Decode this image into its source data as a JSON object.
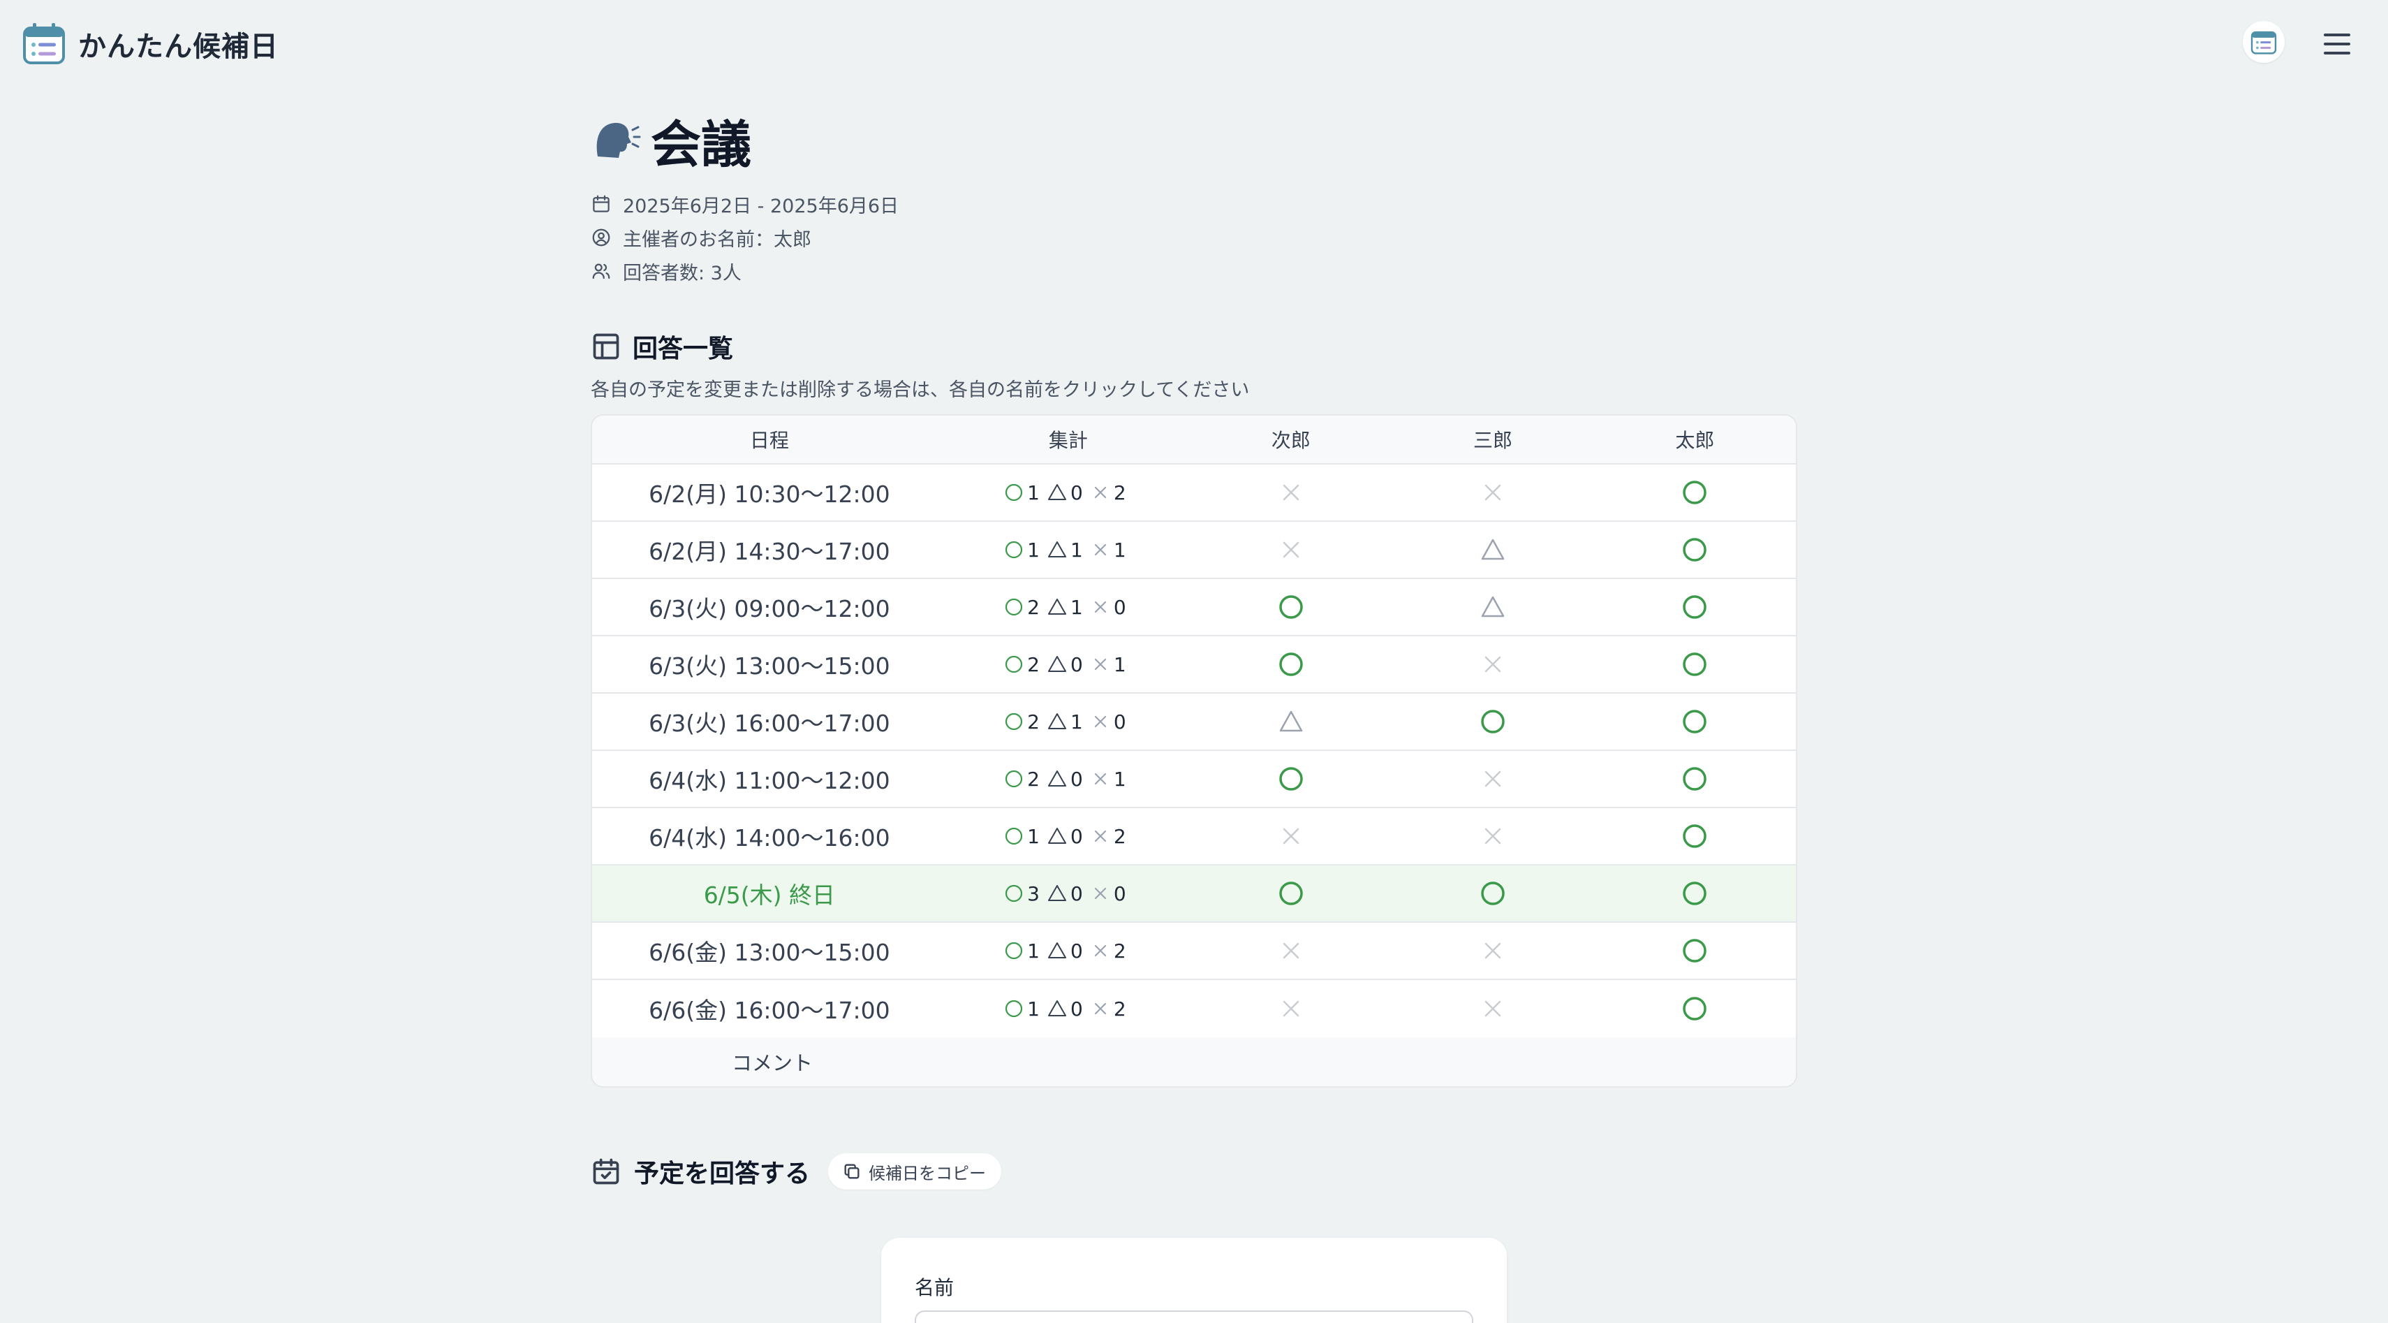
{
  "app": {
    "name": "かんたん候補日"
  },
  "event": {
    "title": "会議",
    "emoji": "🗣️",
    "date_range": "2025年6月2日 - 2025年6月6日",
    "organizer": "主催者のお名前：太郎",
    "respondents": "回答者数: 3人"
  },
  "responses": {
    "title": "回答一覧",
    "hint": "各自の予定を変更または削除する場合は、各自の名前をクリックしてください",
    "headers": {
      "date": "日程",
      "summary": "集計"
    },
    "participants": [
      "次郎",
      "三郎",
      "太郎"
    ],
    "rows": [
      {
        "date": "6/2(月) 10:30〜12:00",
        "ok": "1",
        "maybe": "0",
        "ng": "2",
        "marks": [
          "ng",
          "ng",
          "ok"
        ],
        "best": false
      },
      {
        "date": "6/2(月) 14:30〜17:00",
        "ok": "1",
        "maybe": "1",
        "ng": "1",
        "marks": [
          "ng",
          "maybe",
          "ok"
        ],
        "best": false
      },
      {
        "date": "6/3(火) 09:00〜12:00",
        "ok": "2",
        "maybe": "1",
        "ng": "0",
        "marks": [
          "ok",
          "maybe",
          "ok"
        ],
        "best": false
      },
      {
        "date": "6/3(火) 13:00〜15:00",
        "ok": "2",
        "maybe": "0",
        "ng": "1",
        "marks": [
          "ok",
          "ng",
          "ok"
        ],
        "best": false
      },
      {
        "date": "6/3(火) 16:00〜17:00",
        "ok": "2",
        "maybe": "1",
        "ng": "0",
        "marks": [
          "maybe",
          "ok",
          "ok"
        ],
        "best": false
      },
      {
        "date": "6/4(水) 11:00〜12:00",
        "ok": "2",
        "maybe": "0",
        "ng": "1",
        "marks": [
          "ok",
          "ng",
          "ok"
        ],
        "best": false
      },
      {
        "date": "6/4(水) 14:00〜16:00",
        "ok": "1",
        "maybe": "0",
        "ng": "2",
        "marks": [
          "ng",
          "ng",
          "ok"
        ],
        "best": false
      },
      {
        "date": "6/5(木) 終日",
        "ok": "3",
        "maybe": "0",
        "ng": "0",
        "marks": [
          "ok",
          "ok",
          "ok"
        ],
        "best": true
      },
      {
        "date": "6/6(金) 13:00〜15:00",
        "ok": "1",
        "maybe": "0",
        "ng": "2",
        "marks": [
          "ng",
          "ng",
          "ok"
        ],
        "best": false
      },
      {
        "date": "6/6(金) 16:00〜17:00",
        "ok": "1",
        "maybe": "0",
        "ng": "2",
        "marks": [
          "ng",
          "ng",
          "ok"
        ],
        "best": false
      }
    ],
    "comment_label": "コメント"
  },
  "reply": {
    "title": "予定を回答する",
    "copy_button": "候補日をコピー",
    "name_label": "名前"
  },
  "icons": {
    "logo": "calendar-list-icon",
    "header_avatar": "calendar-list-icon",
    "menu": "hamburger-menu-icon",
    "date": "calendar-icon",
    "organizer": "user-circle-icon",
    "respondents": "users-icon",
    "table": "table-icon",
    "reply": "calendar-check-icon",
    "copy": "copy-icon"
  },
  "colors": {
    "ok": "#3b9a4a",
    "maybe": "#9ca3af",
    "ng": "#c9cdd2",
    "best_row_bg": "#eef8ef",
    "page_bg": "#eef2f3"
  }
}
